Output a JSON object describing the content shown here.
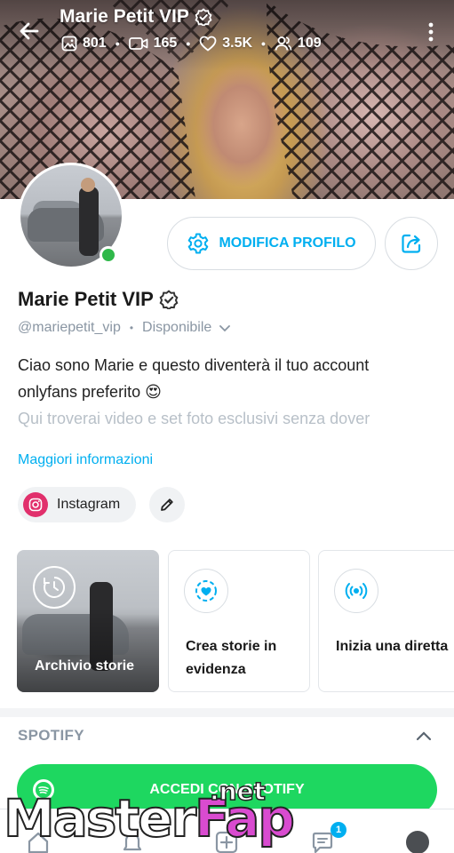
{
  "header": {
    "title": "Marie Petit VIP",
    "stats": {
      "photos": "801",
      "videos": "165",
      "likes": "3.5K",
      "fans": "109"
    }
  },
  "profile": {
    "name": "Marie Petit VIP",
    "handle": "@mariepetit_vip",
    "status": "Disponibile",
    "edit_label": "MODIFICA PROFILO",
    "bio_line1": "Ciao sono Marie e questo diventerà il tuo account",
    "bio_line2": "onlyfans preferito 😍",
    "bio_line3": "Qui troverai video e set foto esclusivi senza dover",
    "more_info": "Maggiori informazioni",
    "instagram_label": "Instagram"
  },
  "stories": {
    "archive_label": "Archivio storie",
    "highlight_label": "Crea storie in evidenza",
    "live_label": "Inizia una diretta"
  },
  "spotify": {
    "section_title": "SPOTIFY",
    "button_label": "ACCEDI CON SPOTIFY"
  },
  "nav": {
    "messages_badge": "1"
  },
  "watermark": {
    "part1": "Master",
    "part2": "Fap",
    "suffix": ".net"
  },
  "colors": {
    "accent": "#00aff0",
    "online": "#2fb84a",
    "spotify": "#1ed760",
    "instagram": "#e1306c"
  }
}
